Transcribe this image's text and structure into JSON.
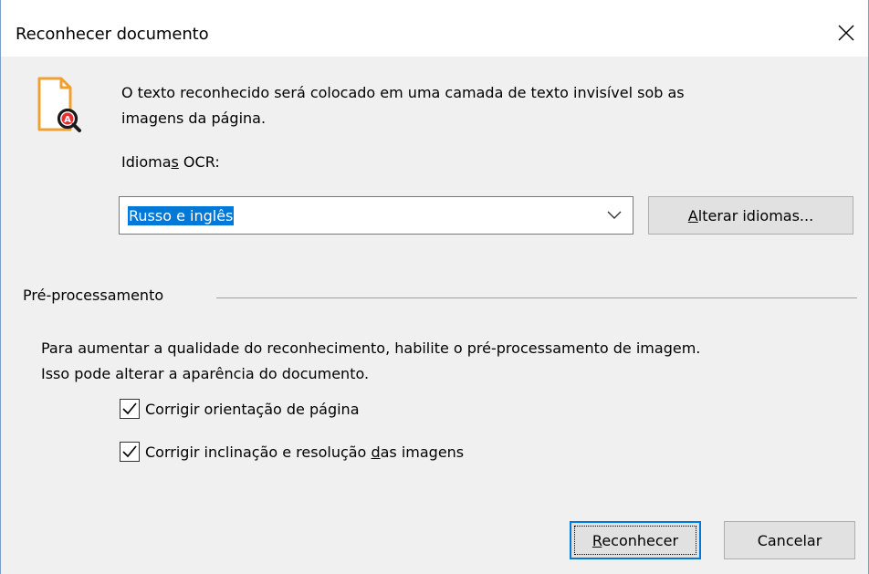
{
  "dialog": {
    "title": "Reconhecer documento"
  },
  "info": {
    "icon": "document-ocr-icon",
    "text_line1": "O texto reconhecido será colocado em uma camada de texto invisível sob as",
    "text_line2": "imagens da página."
  },
  "ocr": {
    "label_pre": "Idioma",
    "label_accel": "s",
    "label_post": " OCR:",
    "selected": "Russo e inglês",
    "change_pre": "",
    "change_accel": "A",
    "change_post": "lterar idiomas..."
  },
  "preprocessing": {
    "group_label": "Pré-processamento",
    "text_line1": "Para aumentar a qualidade do reconhecimento, habilite o pré-processamento de imagem.",
    "text_line2": "Isso pode alterar a aparência do documento.",
    "options": [
      {
        "pre": "Corri",
        "accel": "g",
        "post": "ir orientação de página",
        "checked": true
      },
      {
        "pre": "Corrigir inclinação e resolução ",
        "accel": "d",
        "post": "as imagens",
        "checked": true
      }
    ]
  },
  "buttons": {
    "recognize_pre": "",
    "recognize_accel": "R",
    "recognize_post": "econhecer",
    "cancel": "Cancelar"
  },
  "colors": {
    "accent": "#0078d7",
    "icon_orange": "#f0a030",
    "icon_red": "#e03030"
  }
}
